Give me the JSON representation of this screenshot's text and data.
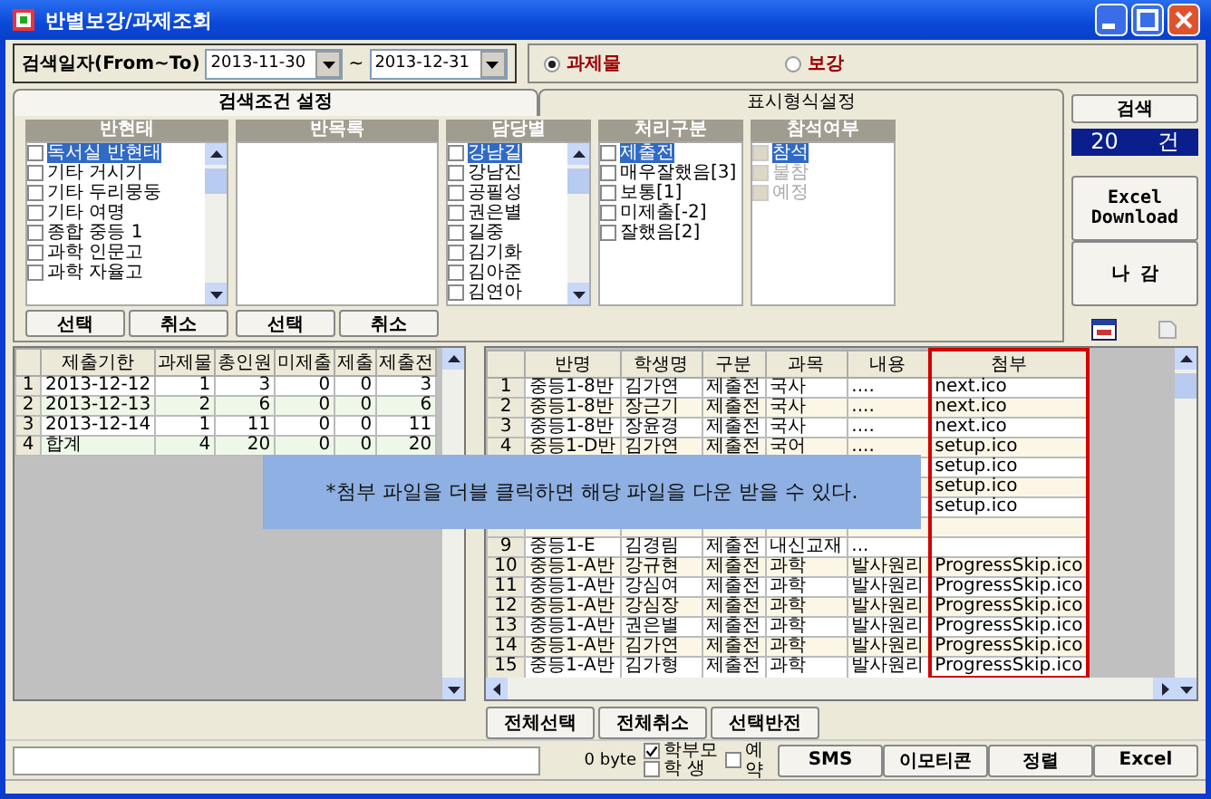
{
  "window": {
    "title": "반별보강/과제조회"
  },
  "search_date": {
    "label": "검색일자(From~To)",
    "from": "2013-11-30",
    "separator": "~",
    "to": "2013-12-31"
  },
  "mode_options": [
    {
      "label": "과제물",
      "selected": true
    },
    {
      "label": "보강",
      "selected": false
    }
  ],
  "tabs": [
    {
      "label": "검색조건 설정",
      "selected": true
    },
    {
      "label": "표시형식설정",
      "selected": false
    }
  ],
  "lists": [
    {
      "header": "반현태",
      "buttons": [
        "선택",
        "취소"
      ],
      "items": [
        {
          "label": "독서실 반현태",
          "selected": true,
          "checked": false,
          "disabled": false
        },
        {
          "label": "기타 거시기",
          "selected": false,
          "checked": false,
          "disabled": false
        },
        {
          "label": "기타 두리뭉둥",
          "selected": false,
          "checked": false,
          "disabled": false
        },
        {
          "label": "기타 여명",
          "selected": false,
          "checked": false,
          "disabled": false
        },
        {
          "label": "종합 중등 1",
          "selected": false,
          "checked": false,
          "disabled": false
        },
        {
          "label": "과학 인문고",
          "selected": false,
          "checked": false,
          "disabled": false
        },
        {
          "label": "과학 자율고",
          "selected": false,
          "checked": false,
          "disabled": false
        }
      ]
    },
    {
      "header": "반목록",
      "buttons": [
        "선택",
        "취소"
      ]
    },
    {
      "header": "담당별",
      "items": [
        {
          "label": "강남길",
          "selected": true,
          "checked": false,
          "disabled": false
        },
        {
          "label": "강남진",
          "selected": false,
          "checked": false,
          "disabled": false
        },
        {
          "label": "공필성",
          "selected": false,
          "checked": false,
          "disabled": false
        },
        {
          "label": "권은별",
          "selected": false,
          "checked": false,
          "disabled": false
        },
        {
          "label": "길중",
          "selected": false,
          "checked": false,
          "disabled": false
        },
        {
          "label": "김기화",
          "selected": false,
          "checked": false,
          "disabled": false
        },
        {
          "label": "김아준",
          "selected": false,
          "checked": false,
          "disabled": false
        },
        {
          "label": "김연아",
          "selected": false,
          "checked": false,
          "disabled": false
        }
      ]
    },
    {
      "header": "처리구분",
      "items": [
        {
          "label": "제출전",
          "selected": true,
          "checked": false,
          "disabled": false
        },
        {
          "label": "매우잘했음[3]",
          "selected": false,
          "checked": false,
          "disabled": false
        },
        {
          "label": "보통[1]",
          "selected": false,
          "checked": false,
          "disabled": false
        },
        {
          "label": "미제출[-2]",
          "selected": false,
          "checked": false,
          "disabled": false
        },
        {
          "label": "잘했음[2]",
          "selected": false,
          "checked": false,
          "disabled": false
        }
      ]
    },
    {
      "header": "참석여부",
      "items": [
        {
          "label": "참석",
          "selected": true,
          "checked": false,
          "disabled": true
        },
        {
          "label": "불참",
          "selected": false,
          "checked": false,
          "disabled": true
        },
        {
          "label": "예정",
          "selected": false,
          "checked": false,
          "disabled": true
        }
      ]
    }
  ],
  "side": {
    "search_button": "검색",
    "count": {
      "value": "20",
      "unit": "건"
    },
    "excel_button": "Excel Download",
    "exit_button": "나 감"
  },
  "summary_table": {
    "columns": [
      "제출기한",
      "과제물",
      "총인원",
      "미제출",
      "제출",
      "제출전"
    ],
    "rows": [
      {
        "num": "1",
        "cells": [
          "2013-12-12",
          "1",
          "3",
          "0",
          "0",
          "3"
        ]
      },
      {
        "num": "2",
        "cells": [
          "2013-12-13",
          "2",
          "6",
          "0",
          "0",
          "6"
        ]
      },
      {
        "num": "3",
        "cells": [
          "2013-12-14",
          "1",
          "11",
          "0",
          "0",
          "11"
        ]
      },
      {
        "num": "4",
        "cells": [
          "합계",
          "4",
          "20",
          "0",
          "0",
          "20"
        ]
      }
    ]
  },
  "detail_table": {
    "columns": [
      "반명",
      "학생명",
      "구분",
      "과목",
      "내용",
      "첨부"
    ],
    "rows": [
      {
        "num": "1",
        "cells": [
          "중등1-8반",
          "김가연",
          "제출전",
          "국사",
          "...."
        ],
        "attachment": "next.ico"
      },
      {
        "num": "2",
        "cells": [
          "중등1-8반",
          "장근기",
          "제출전",
          "국사",
          "...."
        ],
        "attachment": "next.ico"
      },
      {
        "num": "3",
        "cells": [
          "중등1-8반",
          "장윤경",
          "제출전",
          "국사",
          "...."
        ],
        "attachment": "next.ico"
      },
      {
        "num": "4",
        "cells": [
          "중등1-D반",
          "김가연",
          "제출전",
          "국어",
          "...."
        ],
        "attachment": "setup.ico"
      },
      {
        "covered": true,
        "attachment": "setup.ico"
      },
      {
        "covered": true,
        "attachment": "setup.ico"
      },
      {
        "covered": true,
        "attachment": "setup.ico"
      },
      {
        "covered": true
      },
      {
        "num": "9",
        "cells": [
          "중등1-E",
          "김경림",
          "제출전",
          "내신교재",
          "..."
        ]
      },
      {
        "num": "10",
        "cells": [
          "중등1-A반",
          "강규현",
          "제출전",
          "과학",
          "발사원리"
        ],
        "attachment": "ProgressSkip.ico"
      },
      {
        "num": "11",
        "cells": [
          "중등1-A반",
          "강심여",
          "제출전",
          "과학",
          "발사원리"
        ],
        "attachment": "ProgressSkip.ico"
      },
      {
        "num": "12",
        "cells": [
          "중등1-A반",
          "강심장",
          "제출전",
          "과학",
          "발사원리"
        ],
        "attachment": "ProgressSkip.ico"
      },
      {
        "num": "13",
        "cells": [
          "중등1-A반",
          "권은별",
          "제출전",
          "과학",
          "발사원리"
        ],
        "attachment": "ProgressSkip.ico"
      },
      {
        "num": "14",
        "cells": [
          "중등1-A반",
          "김가연",
          "제출전",
          "과학",
          "발사원리"
        ],
        "attachment": "ProgressSkip.ico"
      },
      {
        "num": "15",
        "cells": [
          "중등1-A반",
          "김가형",
          "제출전",
          "과학",
          "발사원리"
        ],
        "attachment": "ProgressSkip.ico"
      }
    ]
  },
  "note": {
    "text": "*첨부 파일을 더블 클릭하면 해당 파일을 다운 받을 수 있다."
  },
  "grid_buttons": [
    "전체선택",
    "전체취소",
    "선택반전"
  ],
  "message": {
    "byte_count": "0 byte",
    "recipients": [
      {
        "label": "학부모",
        "checked": true
      },
      {
        "label": "학 생",
        "checked": false
      }
    ],
    "reservation": {
      "label": "예약",
      "checked": false
    },
    "buttons": [
      "SMS",
      "이모티콘",
      "정렬",
      "Excel"
    ]
  }
}
